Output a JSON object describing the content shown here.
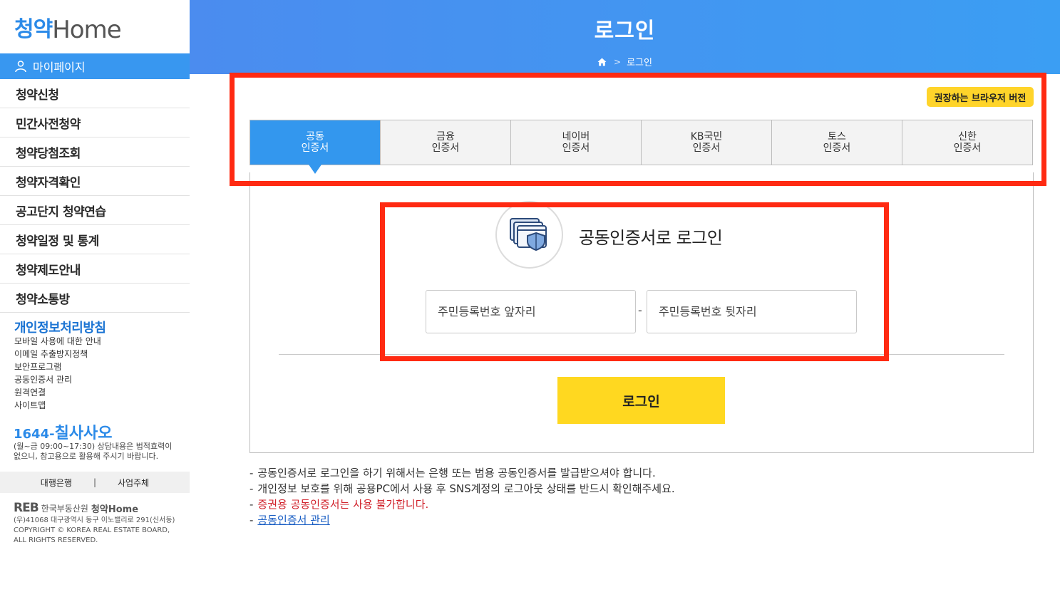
{
  "logo": {
    "ko": "청약",
    "en": "Home"
  },
  "sidebar": {
    "mypage": "마이페이지",
    "menu": [
      "청약신청",
      "민간사전청약",
      "청약당첨조회",
      "청약자격확인",
      "공고단지 청약연습",
      "청약일정 및 통계",
      "청약제도안내",
      "청약소통방"
    ],
    "policy_title": "개인정보처리방침",
    "links": [
      "모바일 사용에 대한 안내",
      "이메일 추출방지정책",
      "보안프로그램",
      "공동인증서 관리",
      "원격연결",
      "사이트맵"
    ],
    "phone_prefix": "1644-",
    "phone_word": "칠사사오",
    "hours_line1": "(월~금 09:00~17:30) 상담내용은 법적효력이",
    "hours_line2": "없으니, 참고용으로 활용해 주시기 바랍니다.",
    "bank_left": "대행은행",
    "bank_sep": "|",
    "bank_right": "사업주체",
    "footer_logo_reb": "REB",
    "footer_logo_org": "한국부동산원",
    "footer_logo_ch": "청약Home",
    "address": "(우)41068 대구광역시 동구 이노밸리로 291(신서동)",
    "copyright1": "COPYRIGHT © KOREA REAL ESTATE BOARD,",
    "copyright2": "ALL RIGHTS RESERVED."
  },
  "header": {
    "title": "로그인",
    "breadcrumb": "로그인"
  },
  "browser_badge": "권장하는 브라우저 버전",
  "tabs": [
    {
      "line1": "공동",
      "line2": "인증서",
      "active": true
    },
    {
      "line1": "금융",
      "line2": "인증서",
      "active": false
    },
    {
      "line1": "네이버",
      "line2": "인증서",
      "active": false
    },
    {
      "line1": "KB국민",
      "line2": "인증서",
      "active": false
    },
    {
      "line1": "토스",
      "line2": "인증서",
      "active": false
    },
    {
      "line1": "신한",
      "line2": "인증서",
      "active": false
    }
  ],
  "login": {
    "title": "공동인증서로 로그인",
    "rrn_front_placeholder": "주민등록번호 앞자리",
    "rrn_back_placeholder": "주민등록번호 뒷자리",
    "rrn_dash": "-",
    "button": "로그인"
  },
  "notes": [
    "공동인증서로 로그인을 하기 위해서는 은행 또는 범용 공동인증서를 발급받으셔야 합니다.",
    "개인정보 보호를 위해 공용PC에서 사용 후 SNS계정의 로그아웃 상태를 반드시 확인해주세요.",
    "증권용 공동인증서는 사용 불가합니다.",
    "공동인증서 관리"
  ],
  "note_dash": "-",
  "colors": {
    "accent": "#3397ee",
    "button": "#ffd820",
    "highlight": "#ff2a12",
    "warning": "#d0202a"
  }
}
